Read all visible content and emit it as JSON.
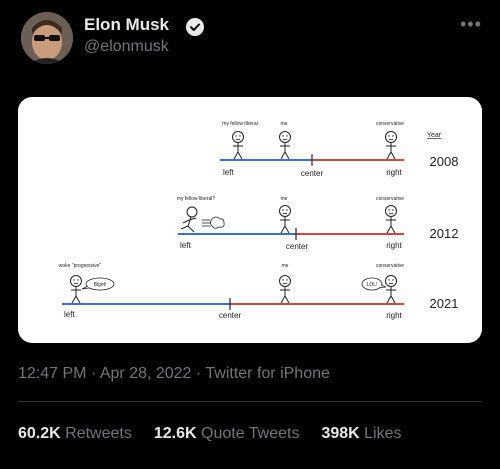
{
  "tweet": {
    "display_name": "Elon Musk",
    "handle": "@elonmusk",
    "time": "12:47 PM",
    "date": "Apr 28, 2022",
    "source": "Twitter for iPhone",
    "stats": [
      {
        "value": "60.2K",
        "label": "Retweets"
      },
      {
        "value": "12.6K",
        "label": "Quote Tweets"
      },
      {
        "value": "398K",
        "label": "Likes"
      }
    ]
  },
  "comic": {
    "year_header": "Year",
    "rows": [
      {
        "year": "2008",
        "left": "left",
        "center": "center",
        "right": "right",
        "liberal_label": "my fellow liberal",
        "me_label": "me",
        "conservative_label": "conservative"
      },
      {
        "year": "2012",
        "left": "left",
        "center": "center",
        "right": "right",
        "liberal_label": "my fellow liberal?",
        "me_label": "me",
        "conservative_label": "conservative"
      },
      {
        "year": "2021",
        "left": "left",
        "center": "center",
        "right": "right",
        "liberal_label": "woke \"progressive\"",
        "me_label": "me",
        "conservative_label": "conservative",
        "bubble_left": "Bigot!",
        "bubble_right": "LOL!"
      }
    ]
  },
  "colors": {
    "left_line": "#3b6fd6",
    "right_line": "#d2453b",
    "background": "#000000",
    "muted": "#71767b",
    "verified": "#1d9bf0"
  }
}
